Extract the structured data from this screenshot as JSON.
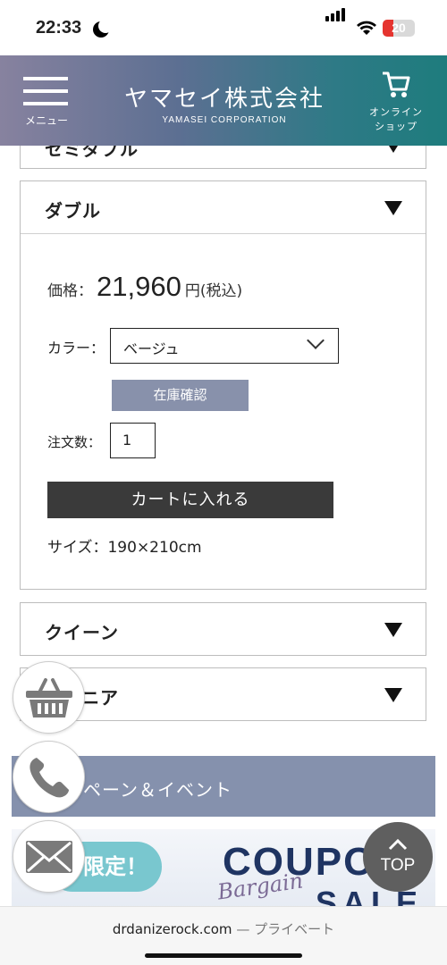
{
  "status_bar": {
    "time": "22:33",
    "battery": "20"
  },
  "header": {
    "menu_label": "メニュー",
    "brand_name": "ヤマセイ株式会社",
    "brand_sub": "YAMASEI CORPORATION",
    "cart_label_line1": "オンライン",
    "cart_label_line2": "ショップ"
  },
  "accordion": {
    "top_partial_label": "セミダブル",
    "double": {
      "title": "ダブル",
      "price_label": "価格：",
      "price_value": "21,960",
      "price_unit": "円(税込)",
      "color_label": "カラー：",
      "color_selected": "ベージュ",
      "stock_button": "在庫確認",
      "qty_label": "注文数：",
      "qty_value": "1",
      "add_to_cart": "カートに入れる",
      "size_text": "サイズ：190×210cm"
    },
    "queen": {
      "title": "クイーン"
    },
    "junior": {
      "title": "ジュニア",
      "visible_text": "ニア"
    }
  },
  "campaign": {
    "title": "キャンペーン＆イベント",
    "visible_text": "ペーン＆イベント"
  },
  "banner": {
    "pill_text": "限定！",
    "coupon_text": "COUPO",
    "bargain_text": "Bargain",
    "sale_text": "SALE"
  },
  "top_button": {
    "label": "TOP"
  },
  "url_bar": {
    "domain": "drdanizerock.com",
    "separator": " — ",
    "mode": "プライベート"
  },
  "colors": {
    "campaign_bg": "#8591ad",
    "stock_button_bg": "#8891ab",
    "add_button_bg": "#3a3a3a",
    "header_gradient_start": "#87829f",
    "header_gradient_end": "#1e7c7d"
  },
  "icons": [
    "menu-icon",
    "cart-icon",
    "basket-icon",
    "phone-icon",
    "mail-icon",
    "chevron-up-icon",
    "chevron-down-icon"
  ]
}
